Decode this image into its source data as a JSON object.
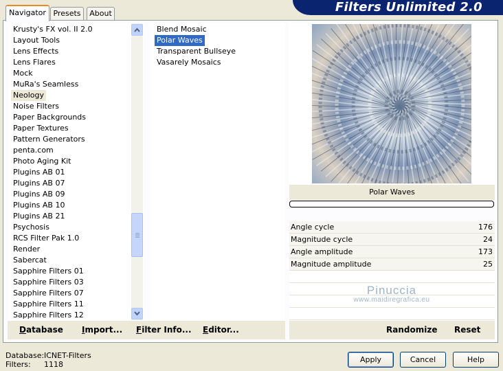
{
  "header": {
    "title": "Filters Unlimited 2.0"
  },
  "tabs": [
    {
      "label": "Navigator",
      "active": true
    },
    {
      "label": "Presets",
      "active": false
    },
    {
      "label": "About",
      "active": false
    }
  ],
  "categories": {
    "items": [
      "Krusty's FX vol. II 2.0",
      "Layout Tools",
      "Lens Effects",
      "Lens Flares",
      "Mock",
      "MuRa's Seamless",
      "Neology",
      "Noise Filters",
      "Paper Backgrounds",
      "Paper Textures",
      "Pattern Generators",
      "penta.com",
      "Photo Aging Kit",
      "Plugins AB 01",
      "Plugins AB 07",
      "Plugins AB 09",
      "Plugins AB 10",
      "Plugins AB 21",
      "Psychosis",
      "RCS Filter Pak 1.0",
      "Render",
      "Sabercat",
      "Sapphire Filters 01",
      "Sapphire Filters 03",
      "Sapphire Filters 07",
      "Sapphire Filters 11",
      "Sapphire Filters 12"
    ],
    "selected": "Neology"
  },
  "filters": {
    "items": [
      "Blend Mosaic",
      "Polar Waves",
      "Transparent Bullseye",
      "Vasarely Mosaics"
    ],
    "selected": "Polar Waves"
  },
  "preview": {
    "filter_name": "Polar Waves"
  },
  "parameters": [
    {
      "label": "Angle cycle",
      "value": "176"
    },
    {
      "label": "Magnitude cycle",
      "value": "24"
    },
    {
      "label": "Angle amplitude",
      "value": "173"
    },
    {
      "label": "Magnitude amplitude",
      "value": "25"
    }
  ],
  "watermark": {
    "name": "Pinuccia",
    "site": "www.maidiregrafica.eu"
  },
  "actions": {
    "database_label": "Database",
    "import_label": "Import...",
    "filter_info_label": "Filter Info...",
    "editor_label": "Editor...",
    "randomize_label": "Randomize",
    "reset_label": "Reset"
  },
  "status": {
    "database_label": "Database:",
    "database_value": "ICNET-Filters",
    "filters_label": "Filters:",
    "filters_value": "1118"
  },
  "buttons": {
    "apply": "Apply",
    "cancel": "Cancel",
    "help": "Help"
  },
  "colors": {
    "banner": "#0a2470",
    "selection": "#316ac5",
    "face": "#ece9d8"
  }
}
